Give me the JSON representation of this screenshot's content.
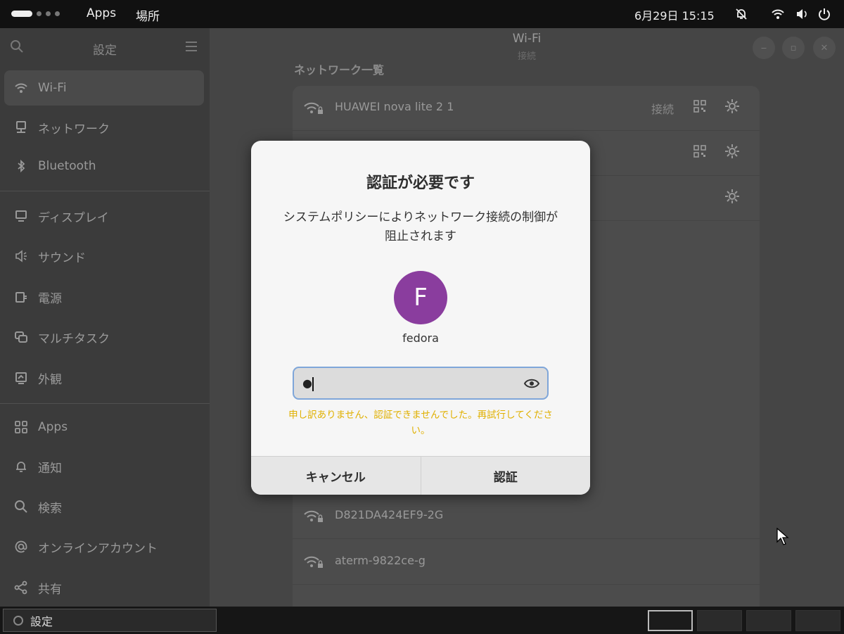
{
  "topbar": {
    "apps_label": "Apps",
    "places_label": "場所",
    "datetime": "6月29日 15:15"
  },
  "sidebar": {
    "title": "設定",
    "items": [
      {
        "label": "Wi-Fi",
        "icon": "wifi-icon",
        "active": true
      },
      {
        "label": "ネットワーク",
        "icon": "network-icon"
      },
      {
        "label": "Bluetooth",
        "icon": "bluetooth-icon"
      },
      {
        "label": "ディスプレイ",
        "icon": "display-icon"
      },
      {
        "label": "サウンド",
        "icon": "sound-icon"
      },
      {
        "label": "電源",
        "icon": "power-icon"
      },
      {
        "label": "マルチタスク",
        "icon": "multitasking-icon"
      },
      {
        "label": "外観",
        "icon": "appearance-icon"
      },
      {
        "label": "Apps",
        "icon": "apps-icon"
      },
      {
        "label": "通知",
        "icon": "bell-icon"
      },
      {
        "label": "検索",
        "icon": "search-icon"
      },
      {
        "label": "オンラインアカウント",
        "icon": "at-icon"
      },
      {
        "label": "共有",
        "icon": "share-icon"
      }
    ]
  },
  "header": {
    "title": "Wi-Fi",
    "subtitle": "接続"
  },
  "network_section_title": "ネットワーク一覧",
  "networks": [
    {
      "name": "HUAWEI nova lite 2 1",
      "status": "接続"
    },
    {
      "name": "D821DA424EF9-2G",
      "status": ""
    },
    {
      "name": "aterm-9822ce-g",
      "status": ""
    }
  ],
  "dialog": {
    "title": "認証が必要です",
    "message": "システムポリシーによりネットワーク接続の制御が阻止されます",
    "avatar_letter": "F",
    "avatar_color": "#8a3d9e",
    "username": "fedora",
    "password_masked": "●",
    "error": "申し訳ありません、認証できませんでした。再試行してください。",
    "error_color": "#e0b000",
    "cancel_label": "キャンセル",
    "auth_label": "認証"
  },
  "taskbar": {
    "task_label": "設定"
  }
}
